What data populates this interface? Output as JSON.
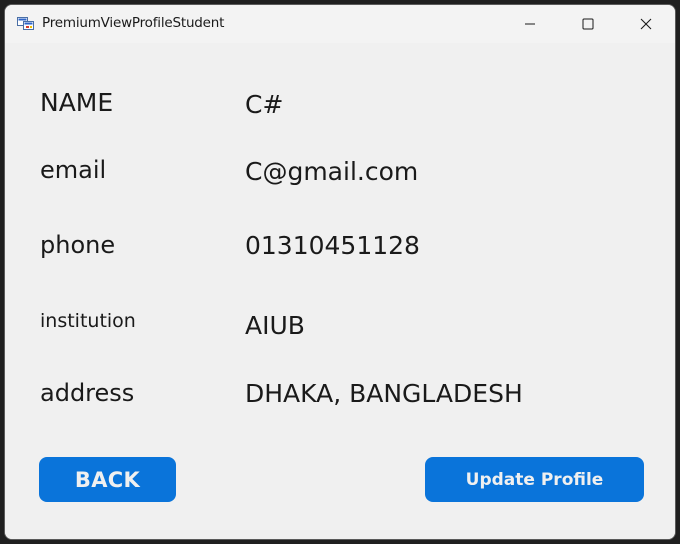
{
  "window": {
    "title": "PremiumViewProfileStudent"
  },
  "profile": {
    "fields": [
      {
        "label": "NAME",
        "value": "C#"
      },
      {
        "label": "email",
        "value": "C@gmail.com"
      },
      {
        "label": "phone",
        "value": "01310451128"
      },
      {
        "label": "institution",
        "value": "AIUB"
      },
      {
        "label": "address",
        "value": "DHAKA, BANGLADESH"
      }
    ]
  },
  "buttons": {
    "back_label": "BACK",
    "update_label": "Update Profile"
  },
  "colors": {
    "button_bg": "#0a74da",
    "button_text": "#f0f0f0",
    "window_bg": "#f0f0f0",
    "text": "#1a1a1a"
  }
}
